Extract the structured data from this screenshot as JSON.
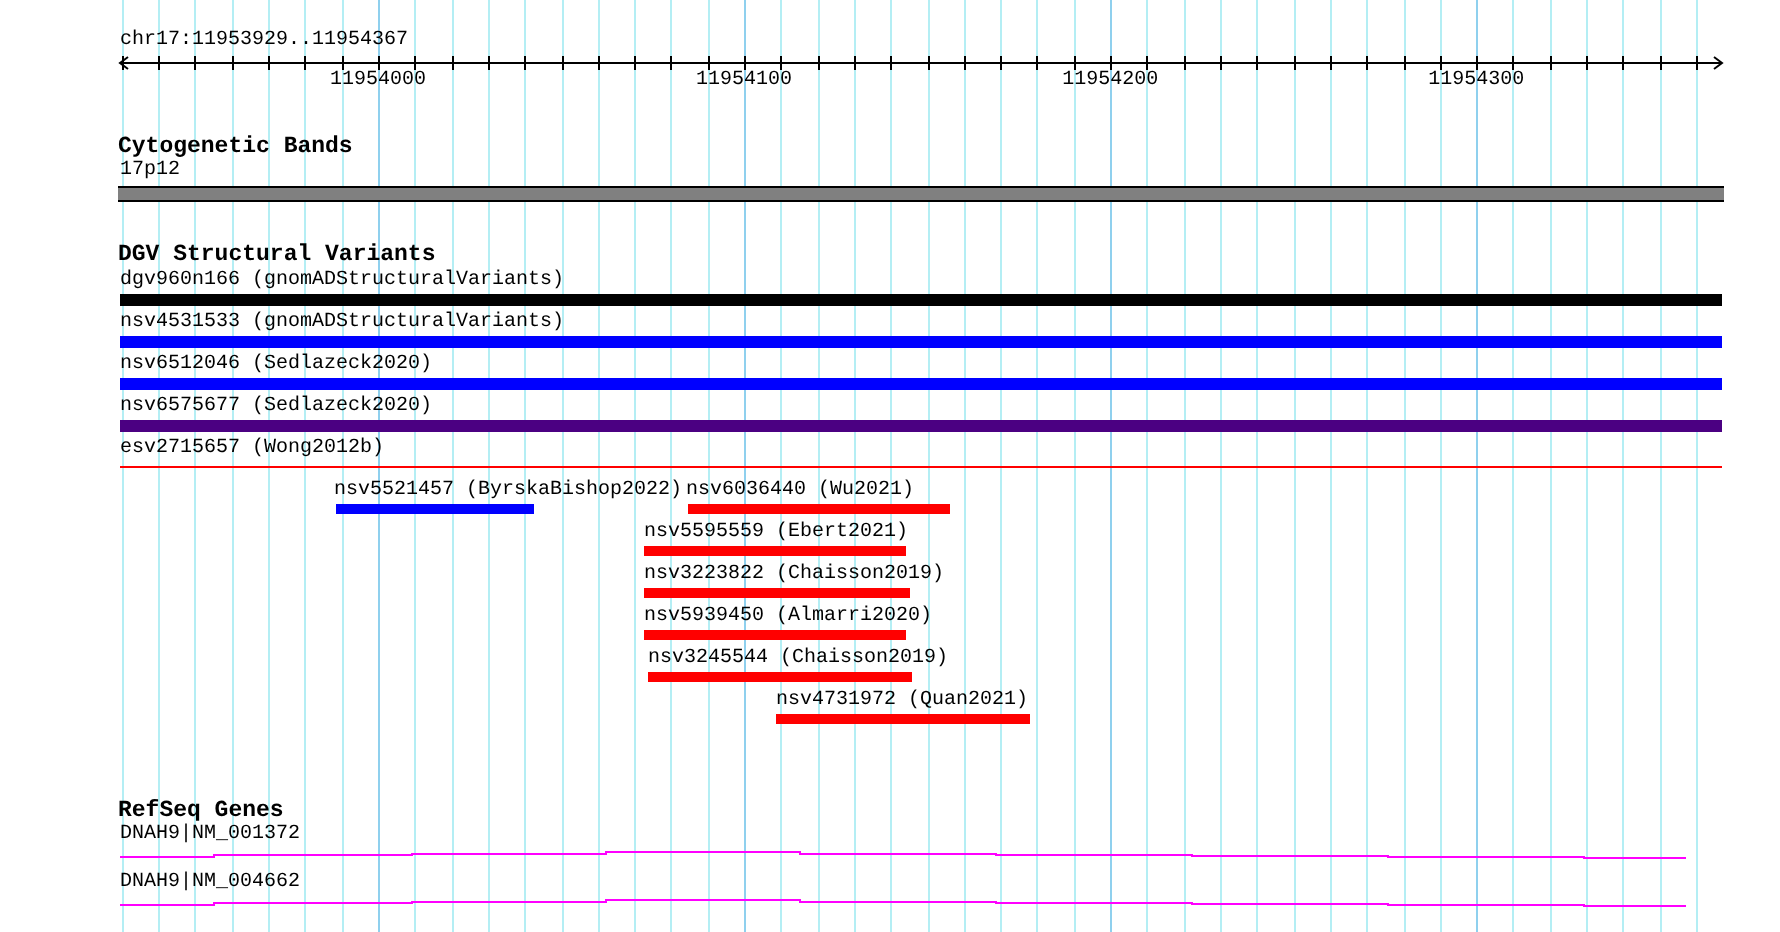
{
  "ruler": {
    "location": "chr17:11953929..11954367",
    "tick_labels": [
      "11954000",
      "11954100",
      "11954200",
      "11954300"
    ]
  },
  "tracks": [
    {
      "title": "Cytogenetic Bands",
      "kind": "band",
      "features": [
        {
          "label": "17p12"
        }
      ]
    },
    {
      "title": "DGV Structural Variants",
      "kind": "variant",
      "features": [
        {
          "label": "dgv960n166 (gnomADStructuralVariants)",
          "color": "#000000"
        },
        {
          "label": "nsv4531533 (gnomADStructuralVariants)",
          "color": "#0000ff"
        },
        {
          "label": "nsv6512046 (Sedlazeck2020)",
          "color": "#0000ff"
        },
        {
          "label": "nsv6575677 (Sedlazeck2020)",
          "color": "#4b0082"
        },
        {
          "label": "esv2715657 (Wong2012b)",
          "color": "#ff0000"
        },
        {
          "label": "nsv5521457 (ByrskaBishop2022)",
          "color": "#0000ff"
        },
        {
          "label": "nsv6036440 (Wu2021)",
          "color": "#ff0000"
        },
        {
          "label": "nsv5595559 (Ebert2021)",
          "color": "#ff0000"
        },
        {
          "label": "nsv3223822 (Chaisson2019)",
          "color": "#ff0000"
        },
        {
          "label": "nsv5939450 (Almarri2020)",
          "color": "#ff0000"
        },
        {
          "label": "nsv3245544 (Chaisson2019)",
          "color": "#ff0000"
        },
        {
          "label": "nsv4731972 (Quan2021)",
          "color": "#ff0000"
        }
      ]
    },
    {
      "title": "RefSeq Genes",
      "kind": "gene",
      "features": [
        {
          "label": "DNAH9|NM_001372"
        },
        {
          "label": "DNAH9|NM_004662"
        }
      ]
    }
  ]
}
